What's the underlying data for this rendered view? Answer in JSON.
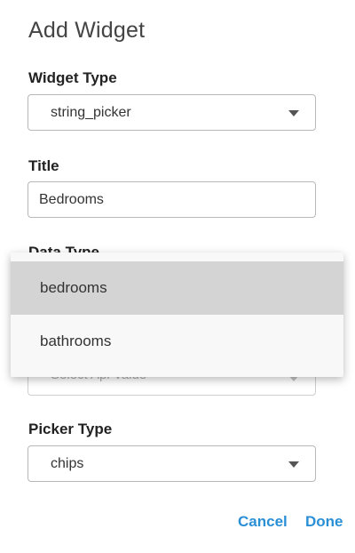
{
  "dialog": {
    "title": "Add Widget"
  },
  "widget_type": {
    "label": "Widget Type",
    "value": "string_picker"
  },
  "title_field": {
    "label": "Title",
    "value": "Bedrooms"
  },
  "data_type": {
    "label": "Data Type"
  },
  "api_value": {
    "placeholder": "Select Api Value"
  },
  "dropdown": {
    "options": [
      {
        "label": "bedrooms",
        "highlighted": true
      },
      {
        "label": "bathrooms",
        "highlighted": false
      }
    ]
  },
  "picker_type": {
    "label": "Picker Type",
    "value": "chips"
  },
  "actions": {
    "cancel_label": "Cancel",
    "done_label": "Done"
  },
  "colors": {
    "accent": "#2b8fd6",
    "option_highlight": "#d4d4d4"
  }
}
